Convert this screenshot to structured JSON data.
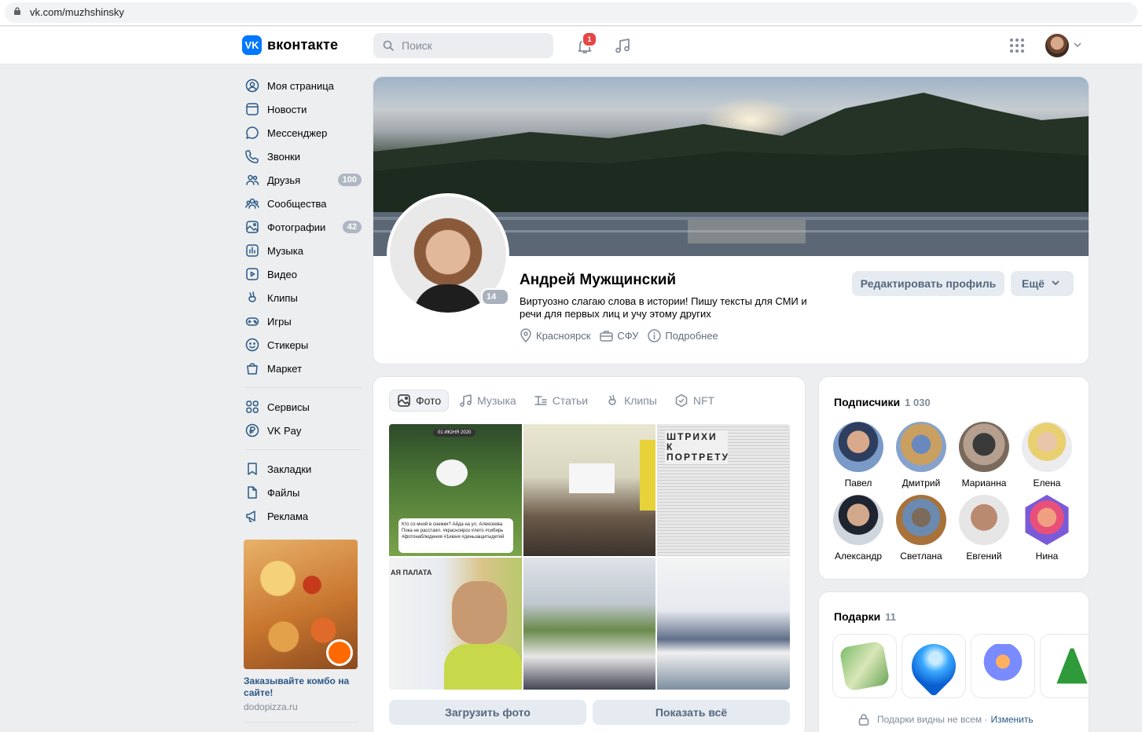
{
  "browser": {
    "url": "vk.com/muzhshinsky"
  },
  "header": {
    "logo_mark": "VK",
    "logo_text": "вконтакте",
    "search_placeholder": "Поиск",
    "notifications_count": "1"
  },
  "nav": {
    "items": [
      {
        "label": "Моя страница",
        "icon": "user-circle-icon"
      },
      {
        "label": "Новости",
        "icon": "newsfeed-icon"
      },
      {
        "label": "Мессенджер",
        "icon": "message-icon"
      },
      {
        "label": "Звонки",
        "icon": "phone-icon"
      },
      {
        "label": "Друзья",
        "icon": "friends-icon",
        "count": "100"
      },
      {
        "label": "Сообщества",
        "icon": "communities-icon"
      },
      {
        "label": "Фотографии",
        "icon": "photo-icon",
        "count": "42"
      },
      {
        "label": "Музыка",
        "icon": "music-icon"
      },
      {
        "label": "Видео",
        "icon": "video-icon"
      },
      {
        "label": "Клипы",
        "icon": "clips-icon"
      },
      {
        "label": "Игры",
        "icon": "gamepad-icon"
      },
      {
        "label": "Стикеры",
        "icon": "smile-icon"
      },
      {
        "label": "Маркет",
        "icon": "market-icon"
      }
    ],
    "items2": [
      {
        "label": "Сервисы",
        "icon": "services-icon"
      },
      {
        "label": "VK Pay",
        "icon": "vkpay-icon"
      }
    ],
    "items3": [
      {
        "label": "Закладки",
        "icon": "bookmark-icon"
      },
      {
        "label": "Файлы",
        "icon": "file-icon"
      },
      {
        "label": "Реклама",
        "icon": "megaphone-icon"
      }
    ],
    "ad": {
      "title": "Заказывайте комбо на сайте!",
      "domain": "dodopizza.ru"
    }
  },
  "profile": {
    "name": "Андрей Мужщинский",
    "status": "Виртуозно слагаю слова в истории! Пишу тексты для СМИ и речи для первых лиц и учу этому других",
    "online": "14 мин",
    "city": "Красноярск",
    "university": "СФУ",
    "more": "Подробнее",
    "edit_button": "Редактировать профиль",
    "more_button": "Ещё"
  },
  "media": {
    "tabs": [
      {
        "label": "Фото",
        "icon": "photo-icon",
        "active": true
      },
      {
        "label": "Музыка",
        "icon": "music-icon"
      },
      {
        "label": "Статьи",
        "icon": "article-icon"
      },
      {
        "label": "Клипы",
        "icon": "clips-icon"
      },
      {
        "label": "NFT",
        "icon": "nft-icon"
      }
    ],
    "photo1_date": "01 ИЮНЯ 2020",
    "photo1_caption": "Кто со мной в снежки? Айда на ул. Алексеева. Пока не расстаял. #красноярск #лето #сибирь #фотонаблюдения #1июня #деньзащитыдетей",
    "photo3_heading": "ШТРИХИ К ПОРТРЕТУ",
    "photo4_sign": "АЯ ПАЛАТА",
    "upload_button": "Загрузить фото",
    "show_all_button": "Показать всё"
  },
  "followers": {
    "title": "Подписчики",
    "count": "1 030",
    "people": [
      {
        "name": "Павел"
      },
      {
        "name": "Дмитрий"
      },
      {
        "name": "Марианна"
      },
      {
        "name": "Елена"
      },
      {
        "name": "Александр"
      },
      {
        "name": "Светлана"
      },
      {
        "name": "Евгений"
      },
      {
        "name": "Нина"
      }
    ]
  },
  "gifts": {
    "title": "Подарки",
    "count": "11",
    "note": "Подарки видны не всем ·",
    "change": "Изменить"
  },
  "colors": {
    "accent": "#2a5885",
    "vk_blue": "#0077ff",
    "badge_red": "#e64646"
  }
}
